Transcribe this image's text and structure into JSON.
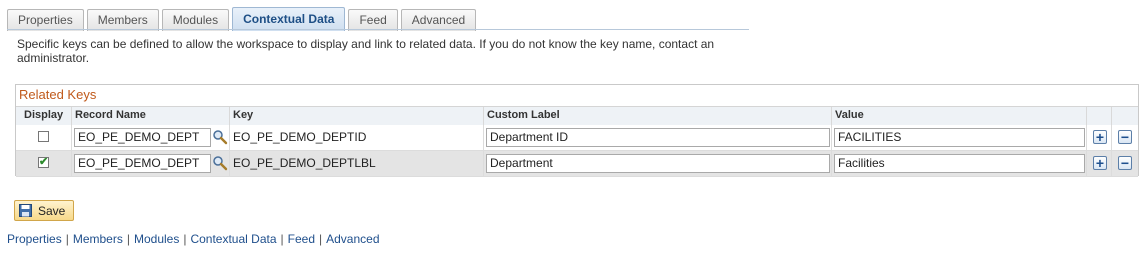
{
  "tabs": [
    {
      "label": "Properties",
      "active": false
    },
    {
      "label": "Members",
      "active": false
    },
    {
      "label": "Modules",
      "active": false
    },
    {
      "label": "Contextual Data",
      "active": true
    },
    {
      "label": "Feed",
      "active": false
    },
    {
      "label": "Advanced",
      "active": false
    }
  ],
  "instructions": "Specific keys can be defined to allow the workspace to display and link to related data. If you do not know the key name, contact an administrator.",
  "grid": {
    "title": "Related Keys",
    "columns": [
      "Display",
      "Record Name",
      "Key",
      "Custom Label",
      "Value"
    ],
    "rows": [
      {
        "display": false,
        "record_name": "EO_PE_DEMO_DEPT",
        "key": "EO_PE_DEMO_DEPTID",
        "custom_label": "Department ID",
        "value": "FACILITIES"
      },
      {
        "display": true,
        "record_name": "EO_PE_DEMO_DEPT",
        "key": "EO_PE_DEMO_DEPTLBL",
        "custom_label": "Department",
        "value": "Facilities"
      }
    ],
    "add_glyph": "+",
    "delete_glyph": "−"
  },
  "save_label": "Save",
  "footer_links": [
    "Properties",
    "Members",
    "Modules",
    "Contextual Data",
    "Feed",
    "Advanced"
  ],
  "footer_separator": "|",
  "icons": {
    "lookup": "magnifier-lookup-icon",
    "save": "floppy-disk-icon",
    "add_row": "add-row-icon",
    "delete_row": "delete-row-icon"
  },
  "colors": {
    "section_title": "#c05a1c",
    "link": "#1f4f8c",
    "active_tab": "#1e4f86"
  }
}
